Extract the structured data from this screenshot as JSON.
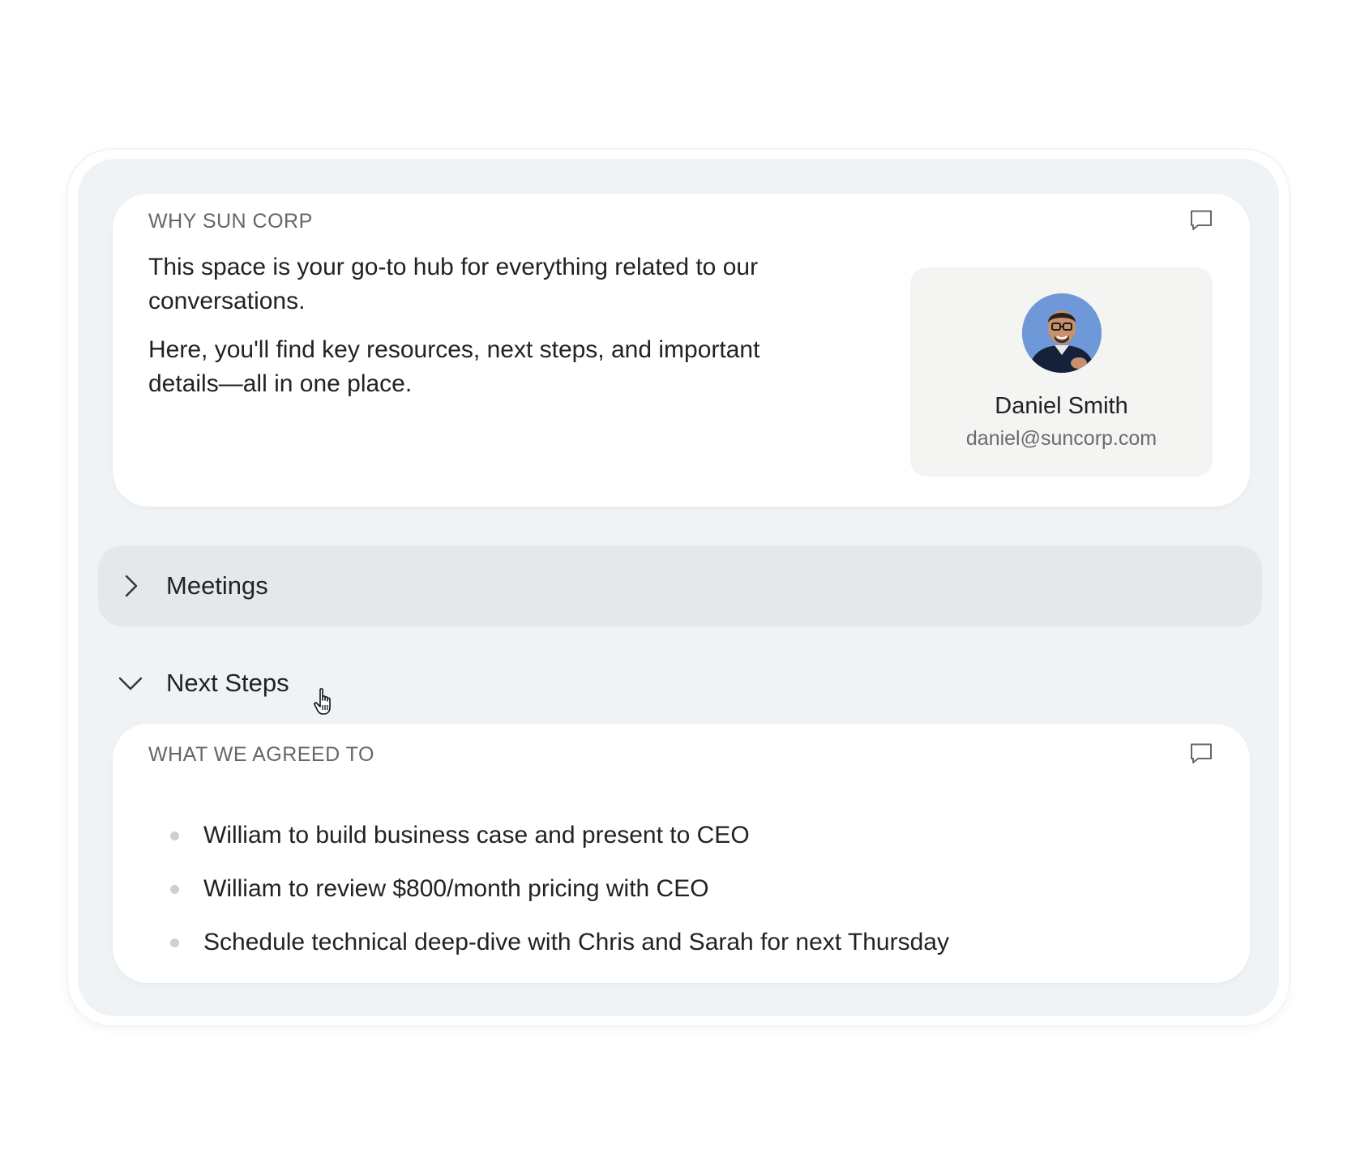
{
  "why_card": {
    "label": "WHY SUN CORP",
    "paragraph_1": "This space is your go-to hub for everything related to our conversations.",
    "paragraph_2": "Here, you'll find key resources, next steps, and important details—all in one place.",
    "comment_icon": "comment-icon"
  },
  "contact": {
    "name": "Daniel Smith",
    "email": "daniel@suncorp.com",
    "avatar_icon": "avatar-photo"
  },
  "accordions": {
    "meetings": {
      "label": "Meetings",
      "expanded": false,
      "icon": "chevron-right-icon"
    },
    "next_steps": {
      "label": "Next Steps",
      "expanded": true,
      "icon": "chevron-down-icon"
    }
  },
  "agreed_card": {
    "label": "WHAT WE AGREED TO",
    "comment_icon": "comment-icon",
    "items": [
      "William to build business case and present to CEO",
      "William to review $800/month pricing with CEO",
      "Schedule technical deep-dive with Chris and Sarah for next Thursday"
    ]
  },
  "colors": {
    "panel_bg": "#eff3f6",
    "card_bg": "#ffffff",
    "accordion_active_bg": "#e5e8eb",
    "contact_bg": "#f4f4f2",
    "label_text": "#666666",
    "body_text": "#222222"
  },
  "cursor_icon": "hand-pointer-icon"
}
